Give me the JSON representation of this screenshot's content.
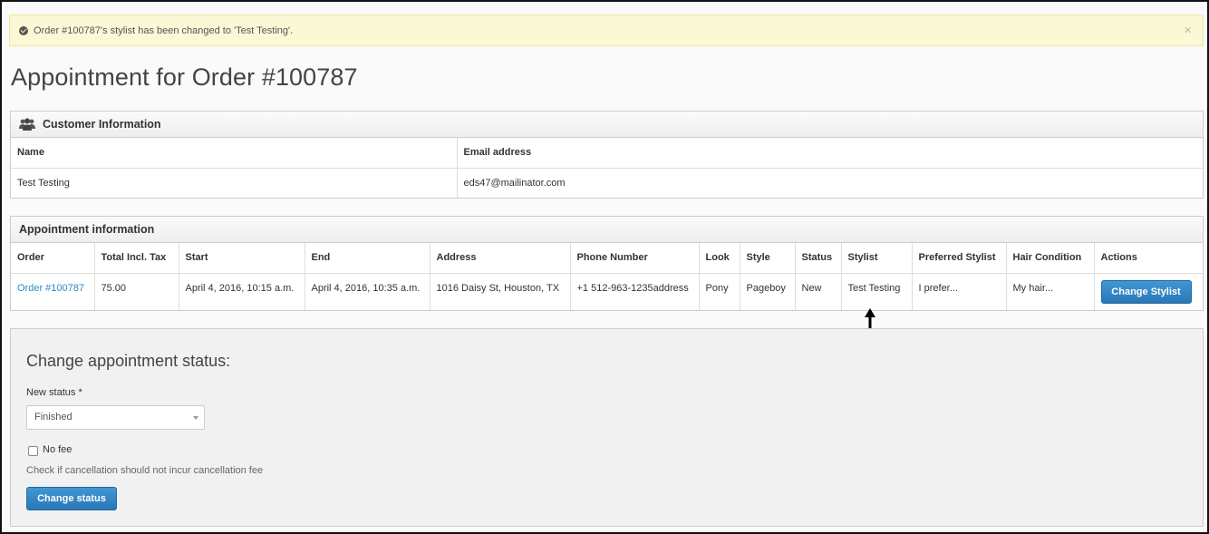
{
  "alert": {
    "message": "Order #100787's stylist has been changed to 'Test Testing'.",
    "close": "×"
  },
  "page": {
    "title": "Appointment for Order #100787"
  },
  "customer": {
    "heading": "Customer Information",
    "columns": [
      "Name",
      "Email address"
    ],
    "row": [
      "Test Testing",
      "eds47@mailinator.com"
    ]
  },
  "appointment": {
    "heading": "Appointment information",
    "columns": [
      "Order",
      "Total Incl. Tax",
      "Start",
      "End",
      "Address",
      "Phone Number",
      "Look",
      "Style",
      "Status",
      "Stylist",
      "Preferred Stylist",
      "Hair Condition",
      "Actions"
    ],
    "row": {
      "order": "Order #100787",
      "total": "75.00",
      "start": "April 4, 2016, 10:15 a.m.",
      "end": "April 4, 2016, 10:35 a.m.",
      "address": "1016 Daisy St, Houston, TX",
      "phone": "+1 512-963-1235address",
      "look": "Pony",
      "style": "Pageboy",
      "status": "New",
      "stylist": "Test Testing",
      "preferred": "I prefer...",
      "hair": "My hair...",
      "action": "Change Stylist"
    }
  },
  "status_form": {
    "title": "Change appointment status:",
    "label": "New status *",
    "selected": "Finished",
    "nofee_label": "No fee",
    "help": "Check if cancellation should not incur cancellation fee",
    "submit": "Change status"
  }
}
